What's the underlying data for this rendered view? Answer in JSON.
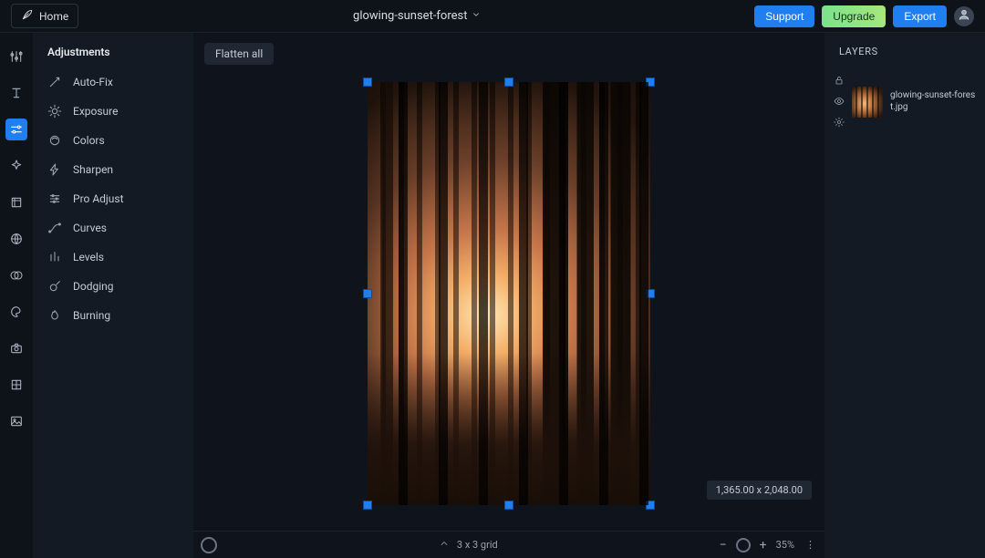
{
  "header": {
    "home_label": "Home",
    "file_name": "glowing-sunset-forest",
    "support_label": "Support",
    "upgrade_label": "Upgrade",
    "export_label": "Export"
  },
  "rail": {
    "items": [
      {
        "name": "levels-tool-icon"
      },
      {
        "name": "text-tool-icon"
      },
      {
        "name": "adjustments-tool-icon"
      },
      {
        "name": "effects-tool-icon"
      },
      {
        "name": "transform-tool-icon"
      },
      {
        "name": "globe-tool-icon"
      },
      {
        "name": "mask-tool-icon"
      },
      {
        "name": "palette-tool-icon"
      },
      {
        "name": "camera-tool-icon"
      },
      {
        "name": "grid-tool-icon"
      },
      {
        "name": "image-tool-icon"
      }
    ],
    "active_index": 2
  },
  "adjustments": {
    "title": "Adjustments",
    "items": [
      {
        "label": "Auto-Fix",
        "icon": "wand-icon"
      },
      {
        "label": "Exposure",
        "icon": "sun-icon"
      },
      {
        "label": "Colors",
        "icon": "orb-icon"
      },
      {
        "label": "Sharpen",
        "icon": "bolt-icon"
      },
      {
        "label": "Pro Adjust",
        "icon": "sliders-icon"
      },
      {
        "label": "Curves",
        "icon": "curves-icon"
      },
      {
        "label": "Levels",
        "icon": "levels-icon"
      },
      {
        "label": "Dodging",
        "icon": "dodge-icon"
      },
      {
        "label": "Burning",
        "icon": "burn-icon"
      }
    ]
  },
  "canvas": {
    "flatten_label": "Flatten all",
    "dimensions_label": "1,365.00 x 2,048.00",
    "grid_label": "3 x 3 grid",
    "zoom_label": "35%"
  },
  "layers": {
    "title": "LAYERS",
    "items": [
      {
        "name": "glowing-sunset-forest.jpg"
      }
    ]
  }
}
